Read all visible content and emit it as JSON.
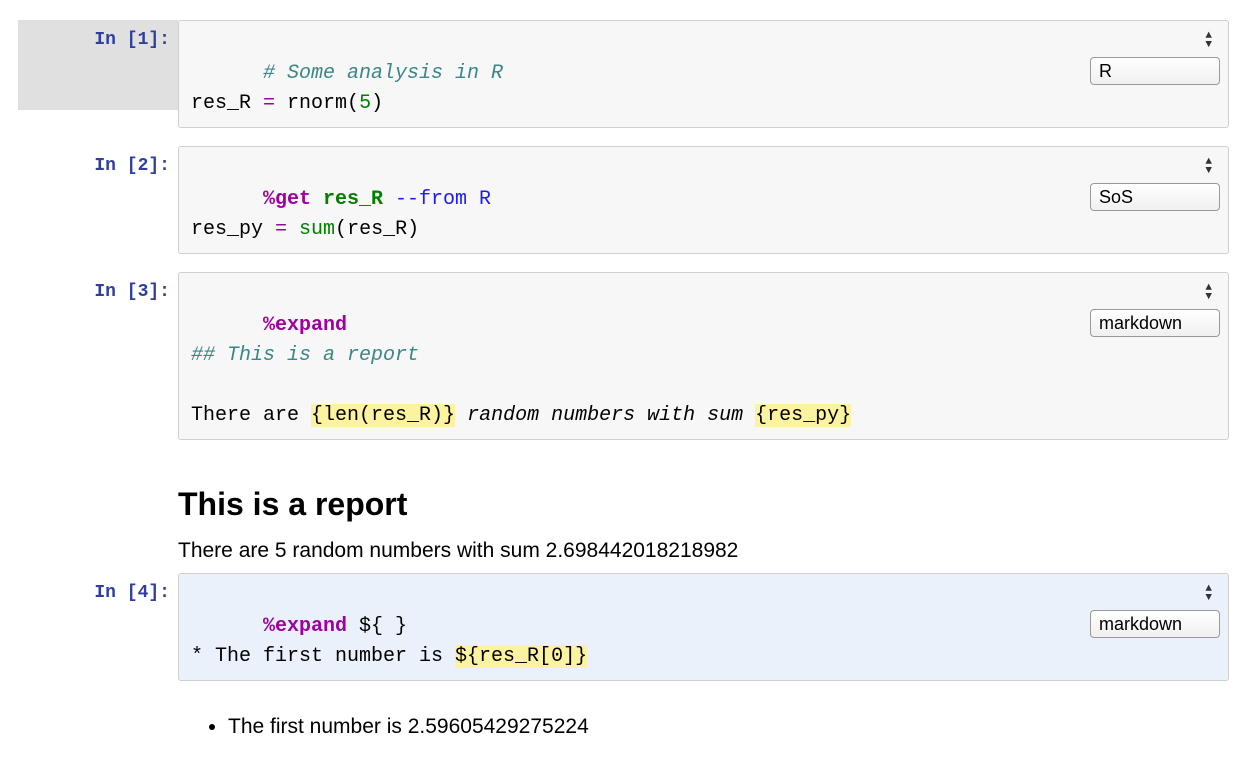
{
  "kernels": [
    "R",
    "SoS",
    "markdown"
  ],
  "cells": [
    {
      "prompt": "In [1]:",
      "kernel": "R",
      "selected": true,
      "code": {
        "line1_comment": "# Some analysis in R",
        "line2_lhs": "res_R",
        "line2_eq": " = ",
        "line2_fn": "rnorm",
        "line2_open": "(",
        "line2_arg": "5",
        "line2_close": ")"
      }
    },
    {
      "prompt": "In [2]:",
      "kernel": "SoS",
      "code": {
        "magic": "%get",
        "magic_arg": " res_R ",
        "flag": "--from R",
        "line2_lhs": "res_py",
        "line2_eq": " = ",
        "line2_fn": "sum",
        "line2_open": "(",
        "line2_arg": "res_R",
        "line2_close": ")"
      }
    },
    {
      "prompt": "In [3]:",
      "kernel": "markdown",
      "code": {
        "magic": "%expand",
        "heading": "## This is a report",
        "text1": "There are ",
        "hl1": "{len(res_R)}",
        "text2": " random numbers with sum ",
        "hl2": "{res_py}"
      },
      "output": {
        "heading": "This is a report",
        "paragraph": "There are 5 random numbers with sum 2.698442018218982"
      }
    },
    {
      "prompt": "In [4]:",
      "kernel": "markdown",
      "active": true,
      "code": {
        "magic": "%expand",
        "magic_tail": " ${ }",
        "line2a": "* The first number is ",
        "hl": "${res_R[0]}"
      },
      "output": {
        "bullet": "The first number is 2.59605429275224"
      }
    }
  ]
}
